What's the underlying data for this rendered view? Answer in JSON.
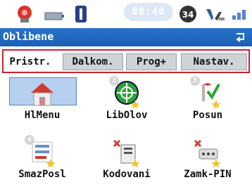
{
  "statusbar": {
    "clock": "08:40",
    "signal_badge": "34",
    "icons": [
      "satellite-icon",
      "battery-icon",
      "bluetooth-icon",
      "gsm-badge-icon",
      "wifi-icon",
      "signal-bars-icon"
    ]
  },
  "titlebar": {
    "title": "Oblibene"
  },
  "tabs": [
    "Pristr.",
    "Dalkom.",
    "Prog+",
    "Nastav."
  ],
  "grid": [
    {
      "label": "HlMenu",
      "icon": "home-icon",
      "badge": ""
    },
    {
      "label": "LibOlov",
      "icon": "target-icon",
      "badge": "2"
    },
    {
      "label": "Posun",
      "icon": "stakeout-icon",
      "badge": "3"
    },
    {
      "label": "SmazPosl",
      "icon": "delete-list-icon",
      "badge": "4"
    },
    {
      "label": "Kodovani",
      "icon": "coding-icon",
      "badge": ""
    },
    {
      "label": "Zamk-PIN",
      "icon": "lock-pin-icon",
      "badge": ""
    }
  ],
  "colors": {
    "accent": "#1a5fb4",
    "highlight": "#d0202a",
    "selected": "#b8d0f0"
  }
}
